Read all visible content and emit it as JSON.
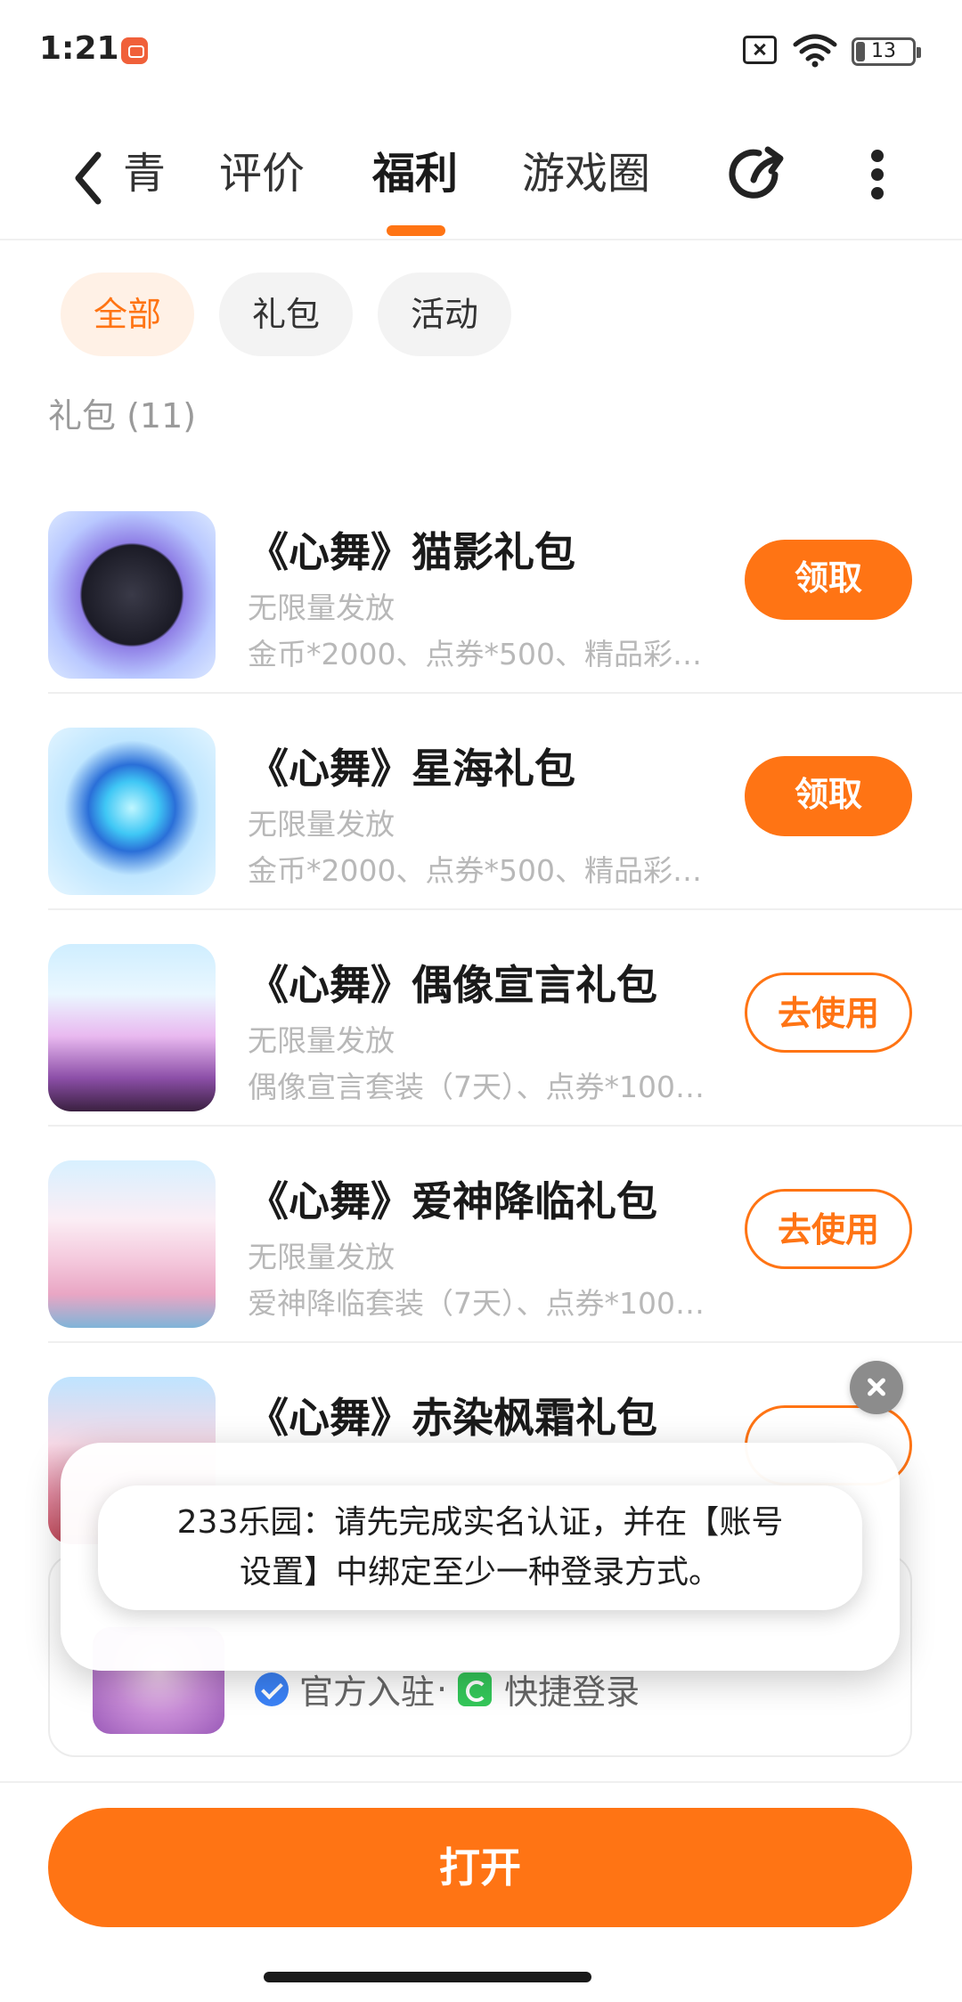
{
  "status_bar": {
    "time": "1:21",
    "battery": "13"
  },
  "nav": {
    "tabs": [
      "青",
      "评价",
      "福利",
      "游戏圈"
    ],
    "active_tab": "福利"
  },
  "filters": [
    "全部",
    "礼包",
    "活动"
  ],
  "section_title": "礼包 (11)",
  "gifts": [
    {
      "title": "《心舞》猫影礼包",
      "limit": "无限量发放",
      "desc": "金币*2000、点券*500、精品彩…",
      "button": "领取"
    },
    {
      "title": "《心舞》星海礼包",
      "limit": "无限量发放",
      "desc": "金币*2000、点券*500、精品彩…",
      "button": "领取"
    },
    {
      "title": "《心舞》偶像宣言礼包",
      "limit": "无限量发放",
      "desc": "偶像宣言套装（7天）、点券*1000…",
      "button": "去使用"
    },
    {
      "title": "《心舞》爱神降临礼包",
      "limit": "无限量发放",
      "desc": "爱神降临套装（7天）、点券*1000…",
      "button": "去使用"
    },
    {
      "title": "《心舞》赤染枫霜礼包"
    }
  ],
  "game_card": {
    "badge_verified": "官方入驻",
    "separator": "·",
    "badge_quick_login": "快捷登录"
  },
  "toast": {
    "line1": "233乐园：请先完成实名认证，并在【账号",
    "line2": "设置】中绑定至少一种登录方式。"
  },
  "open_button": "打开",
  "colors": {
    "accent": "#ff7414",
    "chip_active_bg": "#fff1e6",
    "muted_text": "#b8b8b8"
  },
  "icons": [
    "back-arrow-icon",
    "share-icon",
    "more-icon",
    "close-icon",
    "verified-icon",
    "quick-login-icon",
    "wifi-icon",
    "battery-icon",
    "sim-off-icon"
  ]
}
